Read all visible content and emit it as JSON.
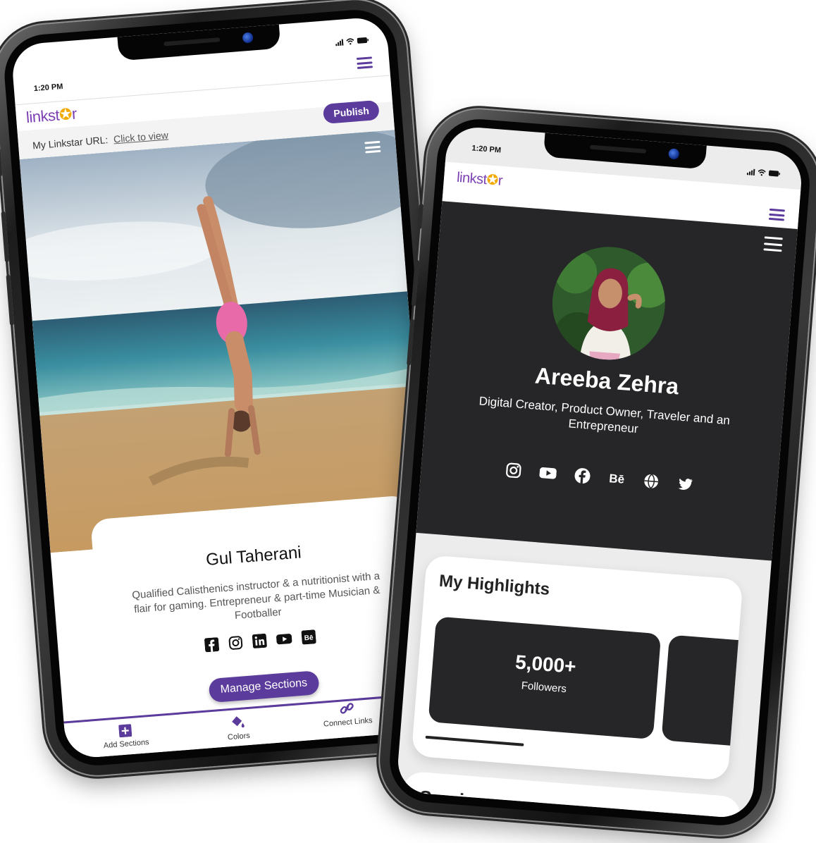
{
  "phone1": {
    "status_time": "1:20 PM",
    "logo_text": "linkst",
    "logo_star": "✪",
    "logo_end": "r",
    "publish_label": "Publish",
    "url_label": "My Linkstar URL:",
    "url_link": "Click to view",
    "profile_name": "Gul Taherani",
    "bio": "Qualified Calisthenics instructor & a nutritionist with a flair for gaming. Entrepreneur & part-time Musician & Footballer",
    "social_icons": [
      "facebook-icon",
      "instagram-icon",
      "linkedin-icon",
      "youtube-icon",
      "behance-icon"
    ],
    "manage_sections_label": "Manage Sections",
    "bottom_nav": [
      {
        "label": "Add Sections",
        "icon": "plus-square-icon"
      },
      {
        "label": "Colors",
        "icon": "paint-bucket-icon"
      },
      {
        "label": "Connect Links",
        "icon": "link-icon"
      }
    ]
  },
  "phone2": {
    "status_time": "1:20 PM",
    "logo_text": "linkst",
    "logo_star": "✪",
    "logo_end": "r",
    "profile_name": "Areeba Zehra",
    "bio": "Digital Creator, Product Owner, Traveler and an Entrepreneur",
    "social_icons": [
      "instagram-icon",
      "youtube-icon",
      "facebook-icon",
      "behance-icon",
      "globe-icon",
      "twitter-icon"
    ],
    "highlights_title": "My Highlights",
    "highlight_value": "5,000+",
    "highlight_label": "Followers",
    "services_title": "Services"
  },
  "colors": {
    "brand_purple": "#5b3b9c",
    "dark_panel": "#262628",
    "logo_star": "#f2a900"
  }
}
